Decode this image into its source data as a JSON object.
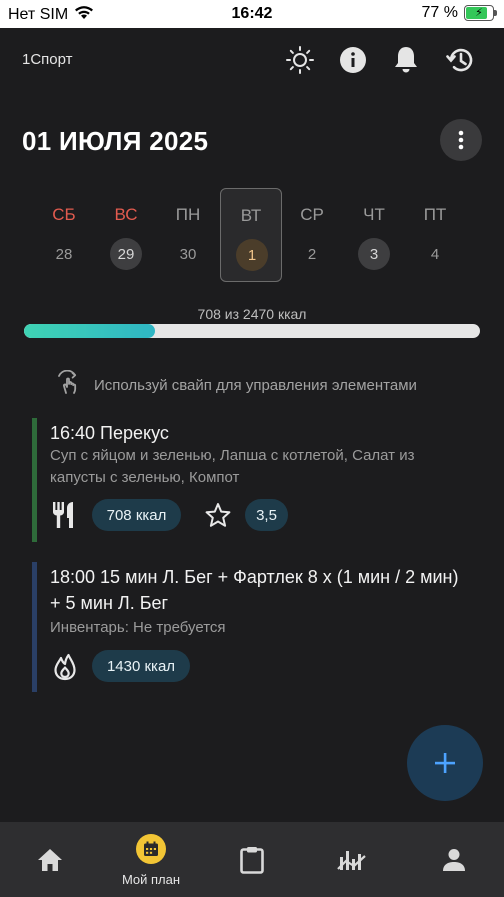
{
  "status_bar": {
    "carrier": "Нет SIM",
    "time": "16:42",
    "battery_percent": "77 %",
    "battery_level": 0.77
  },
  "header": {
    "app_name": "1Спорт",
    "icons": [
      "brightness-icon",
      "info-icon",
      "bell-icon",
      "history-icon"
    ]
  },
  "date_title": "01 ИЮЛЯ 2025",
  "week": [
    {
      "day": "СБ",
      "num": "28",
      "weekend": true,
      "state": "plain"
    },
    {
      "day": "ВС",
      "num": "29",
      "weekend": true,
      "state": "filled"
    },
    {
      "day": "ПН",
      "num": "30",
      "weekend": false,
      "state": "plain"
    },
    {
      "day": "ВТ",
      "num": "1",
      "weekend": false,
      "state": "today"
    },
    {
      "day": "СР",
      "num": "2",
      "weekend": false,
      "state": "plain"
    },
    {
      "day": "ЧТ",
      "num": "3",
      "weekend": false,
      "state": "filled"
    },
    {
      "day": "ПТ",
      "num": "4",
      "weekend": false,
      "state": "plain"
    }
  ],
  "calories": {
    "text": "708 из 2470 ккал",
    "consumed": 708,
    "goal": 2470
  },
  "hint": "Используй свайп для управления элементами",
  "meal_card": {
    "title": "16:40 Перекус",
    "description": "Суп с яйцом и зеленью, Лапша с котлетой, Салат из капусты с зеленью, Компот",
    "kcal": "708 ккал",
    "rating": "3,5",
    "accent": "#2e6b3a"
  },
  "workout_card": {
    "title": "18:00 15 мин Л. Бег + Фартлек 8 х (1 мин / 2 мин) + 5 мин Л. Бег",
    "equipment": "Инвентарь: Не требуется",
    "kcal": "1430 ккал",
    "accent": "#2a3f66"
  },
  "tabs": [
    {
      "icon": "home-icon",
      "label": ""
    },
    {
      "icon": "calendar-icon",
      "label": "Мой план",
      "active": true
    },
    {
      "icon": "clipboard-icon",
      "label": ""
    },
    {
      "icon": "stats-icon",
      "label": ""
    },
    {
      "icon": "profile-icon",
      "label": ""
    }
  ],
  "colors": {
    "background": "#1c1c1e",
    "progress": "#3fd3b4",
    "accent_blue": "#4da3ff",
    "active_tab": "#f2c535",
    "pill": "#1e3b4a"
  }
}
